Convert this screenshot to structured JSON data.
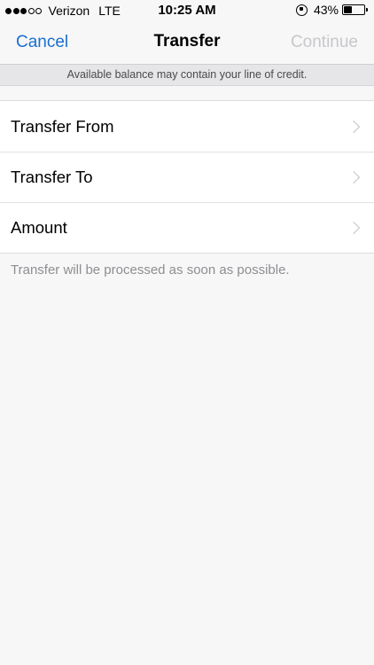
{
  "status_bar": {
    "carrier": "Verizon",
    "network": "LTE",
    "time": "10:25 AM",
    "battery_percent": "43%",
    "battery_level": 0.43,
    "signal_bars_filled": 3,
    "signal_bars_total": 5
  },
  "navbar": {
    "cancel_label": "Cancel",
    "title": "Transfer",
    "continue_label": "Continue"
  },
  "banner": {
    "text": "Available balance may contain your line of credit."
  },
  "rows": [
    {
      "label": "Transfer From",
      "icon": "chevron-right-icon"
    },
    {
      "label": "Transfer To",
      "icon": "chevron-right-icon"
    },
    {
      "label": "Amount",
      "icon": "chevron-right-icon"
    }
  ],
  "footer": {
    "note": "Transfer will be processed as soon as possible."
  },
  "colors": {
    "accent": "#1a6fd1",
    "disabled": "#c7c7cc",
    "background": "#f7f7f7"
  }
}
